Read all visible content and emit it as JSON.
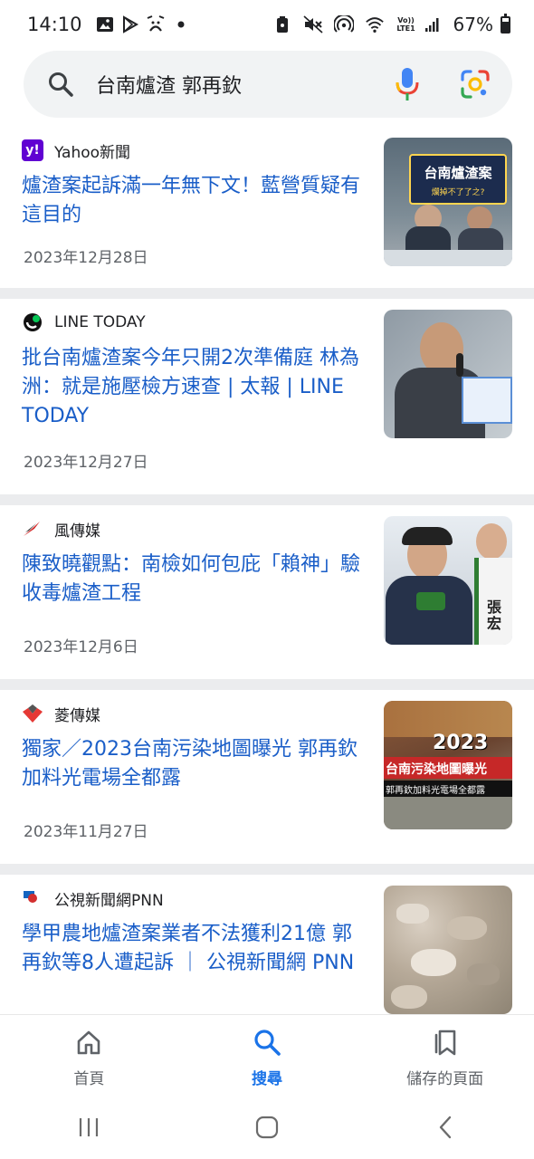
{
  "status": {
    "time": "14:10",
    "battery": "67%",
    "battery_level": 0.67,
    "volte": "Vo)) LTE1"
  },
  "search": {
    "query": "台南爐渣 郭再欽"
  },
  "articles": [
    {
      "source": "Yahoo新聞",
      "logo_text": "y!",
      "logo_color": "#6001d2",
      "title": "爐渣案起訴滿一年無下文！藍營質疑有這目的",
      "date": "2023年12月28日",
      "thumb_text": "台南爐渣案",
      "thumb_subtext": "爛掉不了了之?"
    },
    {
      "source": "LINE TODAY",
      "logo_color": "#111111",
      "title": "批台南爐渣案今年只開2次準備庭 林為洲：就是施壓檢方速查 | 太報 | LINE TODAY",
      "date": "2023年12月27日"
    },
    {
      "source": "風傳媒",
      "logo_color": "#d32f2f",
      "title": "陳致曉觀點：南檢如何包庇「賴神」驗收毒爐渣工程",
      "date": "2023年12月6日",
      "thumb_text": "張宏"
    },
    {
      "source": "菱傳媒",
      "logo_color": "#e53935",
      "title": "獨家／2023台南污染地圖曝光 郭再欽加料光電場全都露",
      "date": "2023年11月27日",
      "thumb_text": "2023",
      "thumb_subtext": "台南污染地圖曝光",
      "thumb_subtext2": "郭再欽加料光電場全都露"
    },
    {
      "source": "公視新聞網PNN",
      "logo_color": "#1565c0",
      "title": "學甲農地爐渣案業者不法獲利21億 郭再欽等8人遭起訴 ｜ 公視新聞網 PNN",
      "date": ""
    }
  ],
  "bottom_nav": {
    "home": "首頁",
    "search": "搜尋",
    "saved": "儲存的頁面"
  }
}
